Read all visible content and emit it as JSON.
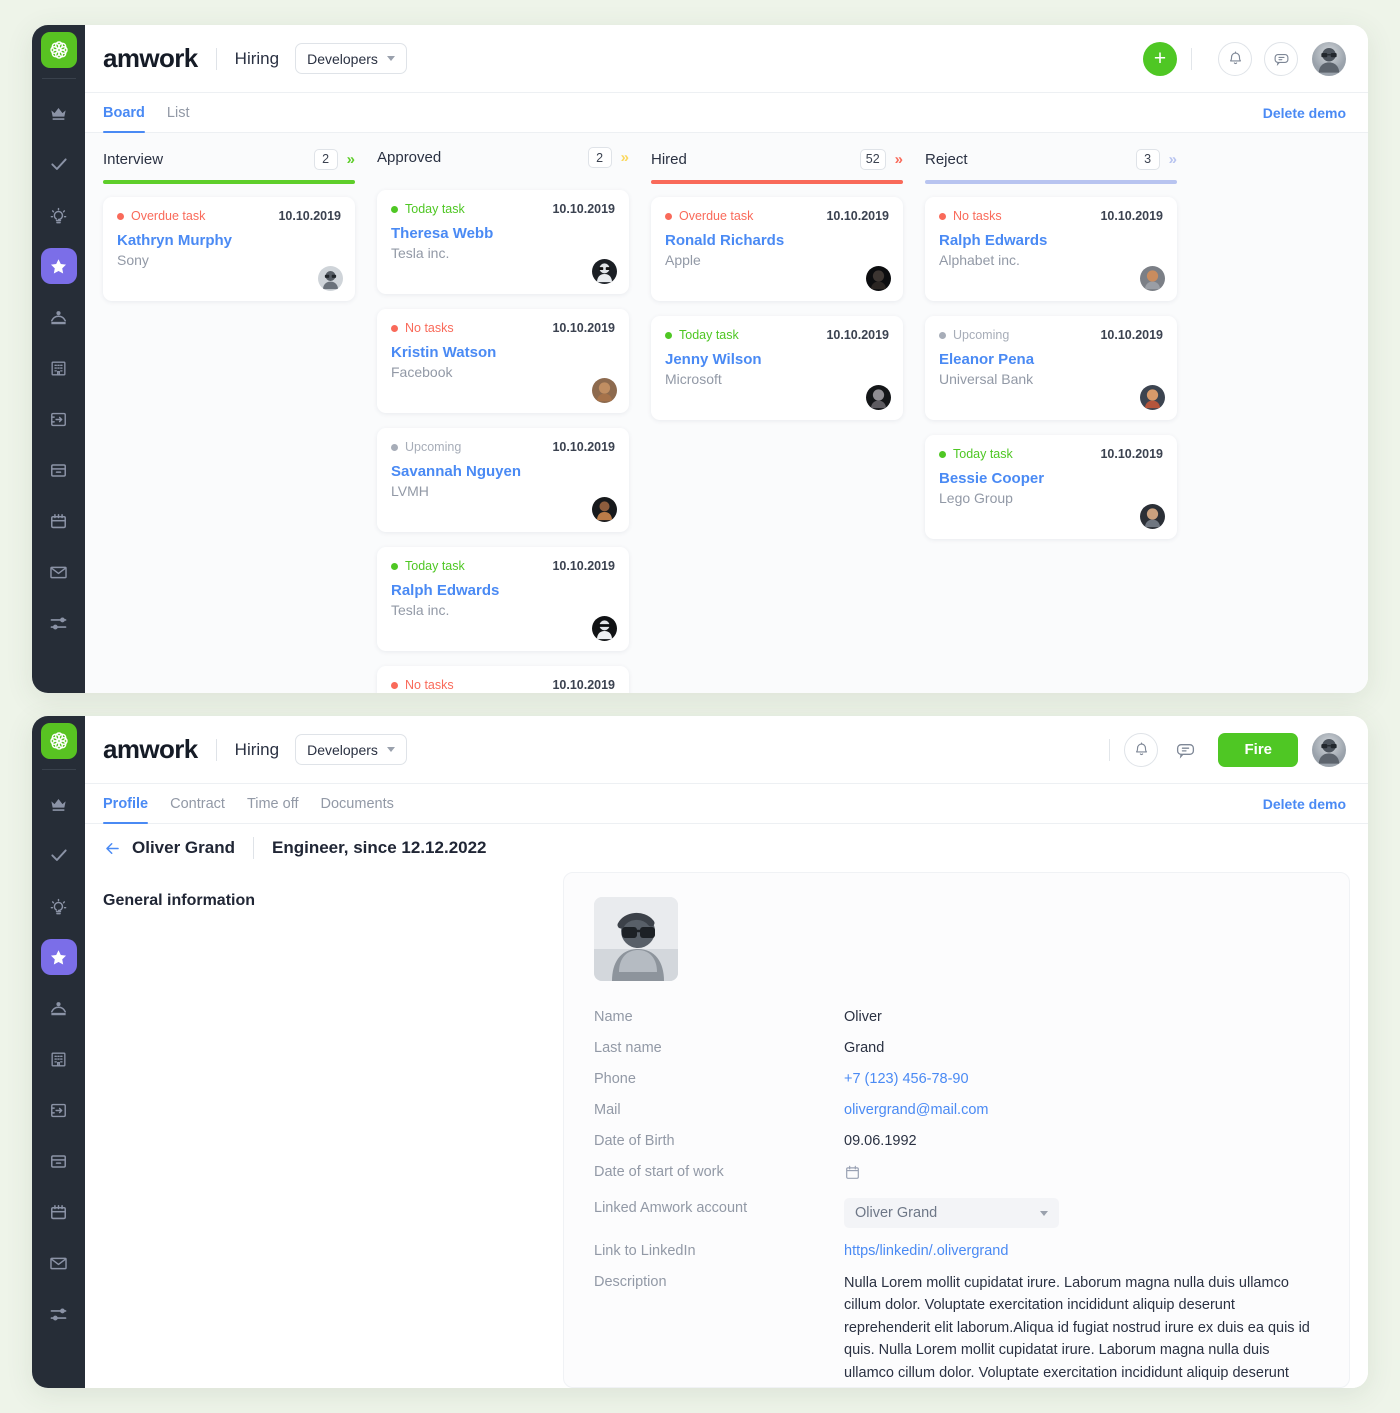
{
  "colors": {
    "brand_green": "#4fc724",
    "accent_blue": "#4a8af4",
    "purple": "#7b6ee8",
    "col_interview": "#5ece2a",
    "col_approved": "#fbd85d",
    "col_hired": "#f96a5a",
    "col_reject": "#b8c4f0",
    "status_overdue": "#f96a5a",
    "status_today": "#4fc724",
    "status_upcoming": "#a7adb8",
    "page_bg": "#eef4e9"
  },
  "sidebar": {
    "logo": "amwork-flower-logo",
    "items": [
      {
        "name": "crown-icon",
        "label": "Premium"
      },
      {
        "name": "check-icon",
        "label": "Tasks"
      },
      {
        "name": "lightbulb-icon",
        "label": "Ideas"
      },
      {
        "name": "star-icon",
        "label": "Favorites",
        "active": true
      },
      {
        "name": "person-card-icon",
        "label": "Contacts"
      },
      {
        "name": "building-icon",
        "label": "Companies"
      },
      {
        "name": "inbox-import-icon",
        "label": "Deals"
      },
      {
        "name": "archive-icon",
        "label": "Archive"
      },
      {
        "name": "calendar-icon",
        "label": "Calendar"
      },
      {
        "name": "mail-icon",
        "label": "Mail"
      },
      {
        "name": "sliders-icon",
        "label": "Settings"
      }
    ]
  },
  "board_window": {
    "header": {
      "brand": "amwork",
      "section": "Hiring",
      "chip": "Developers",
      "add_button": "+",
      "bell_icon": "bell-icon",
      "chat_icon": "chat-icon",
      "avatar": "user-avatar"
    },
    "tabs": [
      {
        "label": "Board",
        "active": true
      },
      {
        "label": "List",
        "active": false
      }
    ],
    "delete_demo": "Delete demo",
    "columns": [
      {
        "title": "Interview",
        "count": "2",
        "color": "#5ece2a",
        "cards": [
          {
            "status": "Overdue task",
            "status_color": "#f96a5a",
            "date": "10.10.2019",
            "name": "Kathryn Murphy",
            "company": "Sony"
          }
        ]
      },
      {
        "title": "Approved",
        "count": "2",
        "color": "#fbd85d",
        "cards": [
          {
            "status": "Today task",
            "status_color": "#4fc724",
            "date": "10.10.2019",
            "name": "Theresa Webb",
            "company": "Tesla inc."
          },
          {
            "status": "No tasks",
            "status_color": "#f96a5a",
            "date": "10.10.2019",
            "name": "Kristin Watson",
            "company": "Facebook"
          },
          {
            "status": "Upcoming",
            "status_color": "#a7adb8",
            "date": "10.10.2019",
            "name": "Savannah Nguyen",
            "company": "LVMH"
          },
          {
            "status": "Today task",
            "status_color": "#4fc724",
            "date": "10.10.2019",
            "name": "Ralph Edwards",
            "company": "Tesla inc."
          },
          {
            "status": "No tasks",
            "status_color": "#f96a5a",
            "date": "10.10.2019",
            "name": "",
            "company": ""
          }
        ]
      },
      {
        "title": "Hired",
        "count": "52",
        "color": "#f96a5a",
        "cards": [
          {
            "status": "Overdue task",
            "status_color": "#f96a5a",
            "date": "10.10.2019",
            "name": "Ronald Richards",
            "company": "Apple"
          },
          {
            "status": "Today task",
            "status_color": "#4fc724",
            "date": "10.10.2019",
            "name": "Jenny Wilson",
            "company": "Microsoft"
          }
        ]
      },
      {
        "title": "Reject",
        "count": "3",
        "color": "#b8c4f0",
        "cards": [
          {
            "status": "No tasks",
            "status_color": "#f96a5a",
            "date": "10.10.2019",
            "name": "Ralph Edwards",
            "company": "Alphabet inc."
          },
          {
            "status": "Upcoming",
            "status_color": "#a7adb8",
            "date": "10.10.2019",
            "name": "Eleanor Pena",
            "company": "Universal Bank"
          },
          {
            "status": "Today task",
            "status_color": "#4fc724",
            "date": "10.10.2019",
            "name": "Bessie Cooper",
            "company": "Lego Group"
          }
        ]
      }
    ]
  },
  "profile_window": {
    "header": {
      "brand": "amwork",
      "section": "Hiring",
      "chip": "Developers",
      "bell_icon": "bell-icon",
      "chat_icon": "chat-icon",
      "fire_button": "Fire",
      "avatar": "user-avatar"
    },
    "tabs": [
      {
        "label": "Profile",
        "active": true
      },
      {
        "label": "Contract",
        "active": false
      },
      {
        "label": "Time off",
        "active": false
      },
      {
        "label": "Documents",
        "active": false
      }
    ],
    "delete_demo": "Delete demo",
    "breadcrumb": {
      "back_icon": "arrow-left-icon",
      "name": "Oliver Grand",
      "role": "Engineer, since 12.12.2022"
    },
    "section_title": "General information",
    "photo": "employee-photo",
    "fields": [
      {
        "label": "Name",
        "value": "Oliver",
        "type": "text"
      },
      {
        "label": "Last name",
        "value": "Grand",
        "type": "text"
      },
      {
        "label": "Phone",
        "value": "+7 (123) 456-78-90",
        "type": "link"
      },
      {
        "label": "Mail",
        "value": "olivergrand@mail.com",
        "type": "link"
      },
      {
        "label": "Date of Birth",
        "value": "09.06.1992",
        "type": "text"
      },
      {
        "label": "Date of start of work",
        "value": "",
        "type": "calendar"
      },
      {
        "label": "Linked Amwork account",
        "value": "Oliver Grand",
        "type": "select"
      },
      {
        "label": "Link to LinkedIn",
        "value": "https/linkedin/.olivergrand",
        "type": "link"
      },
      {
        "label": "Description",
        "value": "Nulla Lorem mollit cupidatat irure. Laborum magna nulla duis ullamco cillum dolor. Voluptate exercitation incididunt aliquip deserunt reprehenderit elit laborum.Aliqua id fugiat nostrud irure ex duis ea quis id quis. Nulla Lorem mollit cupidatat irure. Laborum magna nulla duis ullamco cillum dolor. Voluptate exercitation incididunt aliquip deserunt reprehenderit elit laborum.Aliqua id fugi...",
        "type": "paragraph"
      }
    ]
  }
}
